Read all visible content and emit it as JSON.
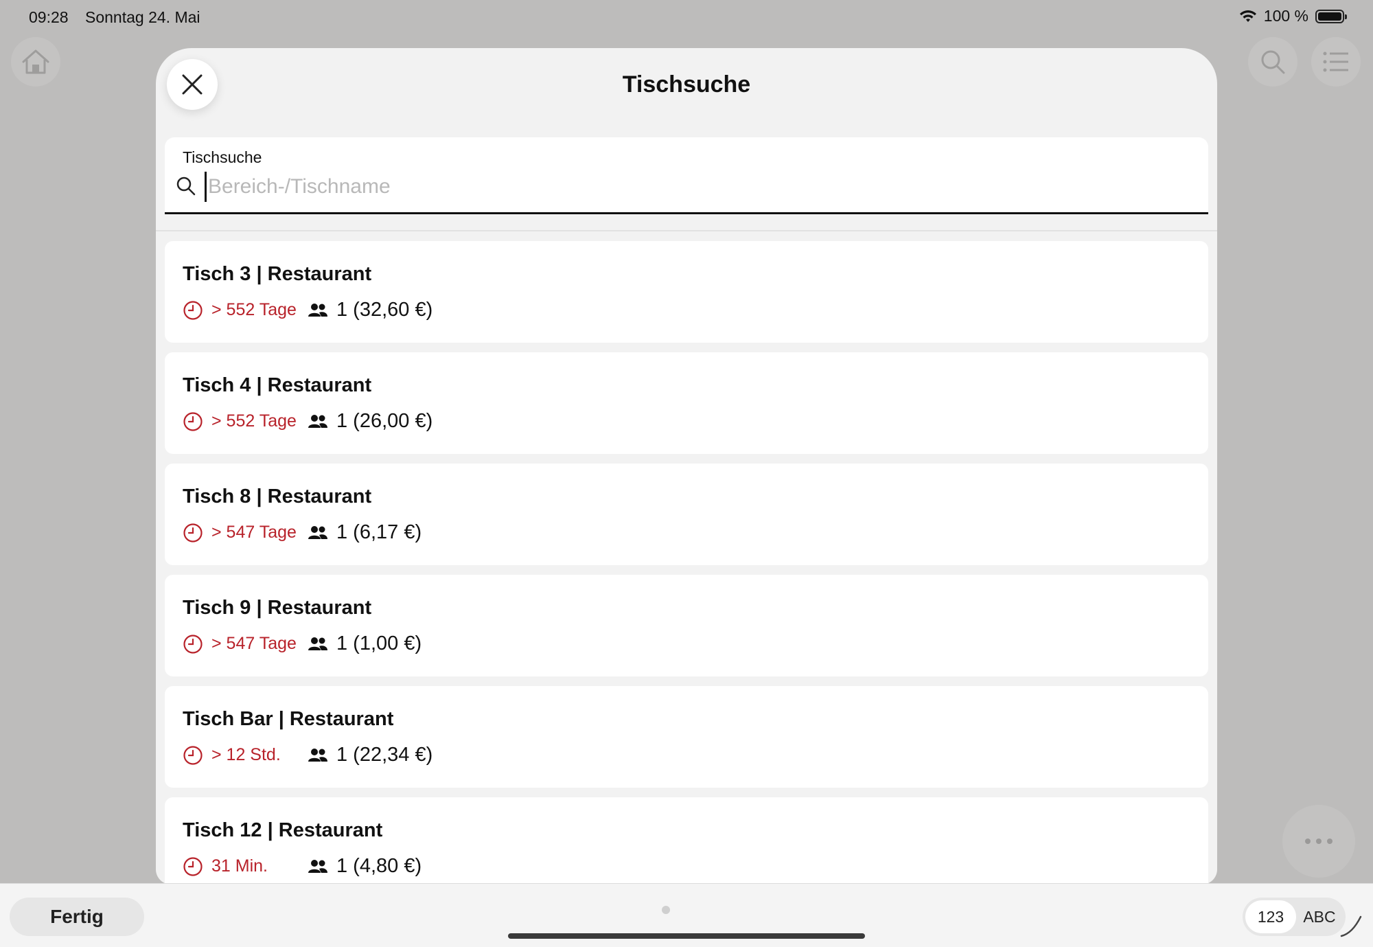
{
  "status_bar": {
    "time": "09:28",
    "date": "Sonntag 24. Mai",
    "battery": "100 %"
  },
  "modal": {
    "title": "Tischsuche",
    "close_icon": "close-icon"
  },
  "search": {
    "label": "Tischsuche",
    "placeholder": "Bereich-/Tischname",
    "value": ""
  },
  "tables": [
    {
      "name": "Tisch 3 | Restaurant",
      "duration": "> 552 Tage",
      "guests": "1 (32,60 €)"
    },
    {
      "name": "Tisch 4 | Restaurant",
      "duration": "> 552 Tage",
      "guests": "1 (26,00 €)"
    },
    {
      "name": "Tisch 8 | Restaurant",
      "duration": "> 547 Tage",
      "guests": "1 (6,17 €)"
    },
    {
      "name": "Tisch 9 | Restaurant",
      "duration": "> 547 Tage",
      "guests": "1 (1,00 €)"
    },
    {
      "name": "Tisch Bar | Restaurant",
      "duration": "> 12 Std.",
      "guests": "1 (22,34 €)"
    },
    {
      "name": "Tisch 12 | Restaurant",
      "duration": "31 Min.",
      "guests": "1 (4,80 €)"
    }
  ],
  "keyboard_bar": {
    "done_label": "Fertig",
    "numeric_label": "123",
    "alpha_label": "ABC"
  },
  "colors": {
    "accent_red": "#b8222a",
    "background": "#bdbcbb",
    "modal_bg": "#f2f2f2"
  }
}
